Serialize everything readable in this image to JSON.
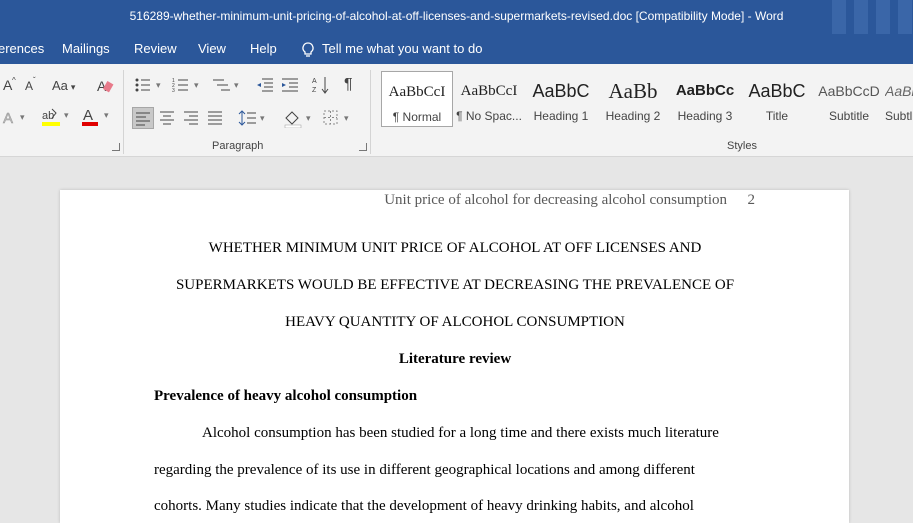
{
  "window": {
    "title": "516289-whether-minimum-unit-pricing-of-alcohol-at-off-licenses-and-supermarkets-revised.doc [Compatibility Mode]  -  Word"
  },
  "ribbon_tabs": [
    "erences",
    "Mailings",
    "Review",
    "View",
    "Help"
  ],
  "tell_me": "Tell me what you want to do",
  "ribbon": {
    "font_aa": "Aa",
    "paragraph_label": "Paragraph",
    "styles_label": "Styles",
    "styles": [
      {
        "preview": "AaBbCcI",
        "name": "¶ Normal"
      },
      {
        "preview": "AaBbCcI",
        "name": "¶ No Spac..."
      },
      {
        "preview": "AaBbC",
        "name": "Heading 1"
      },
      {
        "preview": "AaBb",
        "name": "Heading 2"
      },
      {
        "preview": "AaBbCc",
        "name": "Heading 3"
      },
      {
        "preview": "AaBbC",
        "name": "Title"
      },
      {
        "preview": "AaBbCcD",
        "name": "Subtitle"
      },
      {
        "preview": "AaBl",
        "name": "Subtl"
      }
    ]
  },
  "document": {
    "header_text": "Unit price of alcohol for decreasing alcohol consumption",
    "page_number": "2",
    "title_lines": [
      "WHETHER MINIMUM UNIT PRICE OF ALCOHOL AT OFF LICENSES AND",
      "SUPERMARKETS WOULD BE EFFECTIVE AT DECREASING THE PREVALENCE OF",
      "HEAVY QUANTITY OF ALCOHOL CONSUMPTION"
    ],
    "section_heading": "Literature review",
    "subheading": "Prevalence of heavy alcohol consumption",
    "body_lines": [
      "Alcohol consumption has been studied for a long time and there exists much literature",
      "regarding the prevalence of its use in different geographical locations and among different",
      "cohorts. Many studies indicate that the development of heavy drinking habits, and alcohol"
    ]
  },
  "colors": {
    "word_blue": "#2b579a",
    "ribbon_bg": "#f3f3f3",
    "canvas": "#e6e6e6"
  }
}
